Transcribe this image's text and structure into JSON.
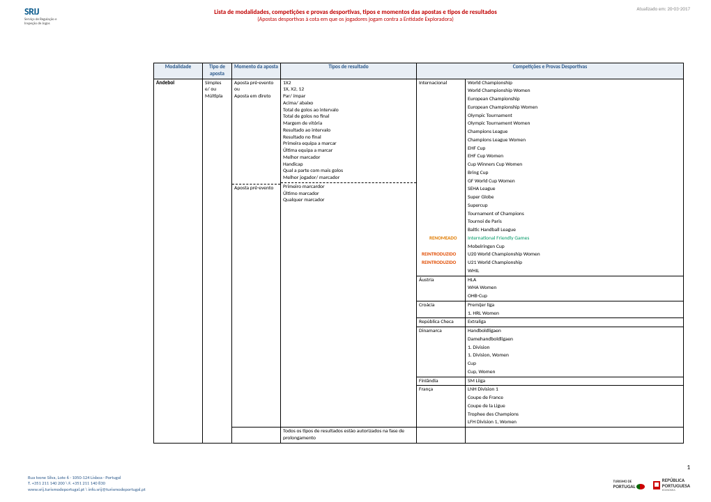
{
  "header": {
    "logo_main": "SRIJ",
    "logo_sub": "Serviço de Regulação e Inspeção de Jogos",
    "date": "Atualizado em: 20-03-2017",
    "title": "Lista de modalidades, competições e provas desportivas, tipos e momentos das apostas e tipos de resultados",
    "subtitle": "(Apostas desportivas à cota em que os jogadores jogam contra a Entidade Exploradora)"
  },
  "columns": {
    "modalidade": "Modalidade",
    "tipo": "Tipo de aposta",
    "momento": "Momento da aposta",
    "tiposres": "Tipos de resultado",
    "comp": "Competições e Provas Desportivas"
  },
  "modalidade": "Andebol",
  "tipo_aposta": [
    "Simples",
    "e/ ou",
    "Múltipla"
  ],
  "momento1": [
    "Aposta pré-evento",
    "ou",
    "Aposta em direto"
  ],
  "momento2": "Aposta pré-evento",
  "tipos_resultado_a": [
    "1X2",
    "1X, X2, 12",
    "Par/ ímpar",
    "Acima/ abaixo",
    "Total de golos ao intervalo",
    "Total de golos no final",
    "Margem de vitória",
    "Resultado ao intervalo",
    "Resultado no final",
    "Primeira equipa a marcar",
    "Última equipa a marcar",
    "Melhor marcador",
    "Handicap",
    "Qual a parte com mais golos",
    "Melhor jogador/ marcador"
  ],
  "tipos_resultado_b": [
    "Primeiro marcardor",
    "Último marcador",
    "Qualquer marcador"
  ],
  "prolong": "Todos os tipos de resultados estão autorizados na fase de prolongamento",
  "groups": [
    {
      "country": "Internacional",
      "comps": [
        {
          "t": "World Championship"
        },
        {
          "t": "World Championship Women"
        },
        {
          "t": "European Championship"
        },
        {
          "t": "European Championship Women"
        },
        {
          "t": "Olympic Tournament"
        },
        {
          "t": "Olympic Tournament Women"
        },
        {
          "t": "Champions League"
        },
        {
          "t": "Champions League Women"
        },
        {
          "t": "EHF Cup"
        },
        {
          "t": "EHF Cup Women"
        },
        {
          "t": "Cup Winners Cup Women"
        },
        {
          "t": "Bring Cup"
        },
        {
          "t": "GF World Cup Women"
        },
        {
          "t": "SEHA League"
        },
        {
          "t": "Super Globe"
        },
        {
          "t": "Supercup"
        },
        {
          "t": "Tournament of Champions"
        },
        {
          "t": "Tournoi de Paris"
        },
        {
          "t": "Baltic Handball League"
        },
        {
          "t": "International Friendly Games",
          "tag": "RENOMEADO",
          "green": true
        },
        {
          "t": "Mobelringen Cup"
        },
        {
          "t": "U20 World Championship Women",
          "tag": "REINTRODUZIDO"
        },
        {
          "t": "U21 World Championship",
          "tag": "REINTRODUZIDO"
        },
        {
          "t": "WHIL"
        }
      ]
    },
    {
      "country": "Áustria",
      "comps": [
        {
          "t": "HLA"
        },
        {
          "t": "WHA Women"
        },
        {
          "t": "OHB-Cup"
        }
      ]
    },
    {
      "country": "Croácia",
      "comps": [
        {
          "t": "Premijer liga"
        },
        {
          "t": "1. HRL Women"
        }
      ]
    },
    {
      "country": "República Checa",
      "comps": [
        {
          "t": "Extraliga"
        }
      ]
    },
    {
      "country": "Dinamarca",
      "comps": [
        {
          "t": "Handboldligaen"
        },
        {
          "t": "Damehandboldligaen"
        },
        {
          "t": "1. Division"
        },
        {
          "t": "1. Division, Women"
        },
        {
          "t": "Cup"
        },
        {
          "t": "Cup, Women"
        }
      ]
    },
    {
      "country": "Finlândia",
      "comps": [
        {
          "t": "SM Liiga"
        }
      ]
    },
    {
      "country": "França",
      "comps": [
        {
          "t": "LNH Division 1"
        },
        {
          "t": "Coupe de France"
        },
        {
          "t": "Coupe de la Ligue"
        },
        {
          "t": "Trophee des Champions"
        },
        {
          "t": "LFH Division 1, Women"
        }
      ]
    }
  ],
  "tags": {
    "renomeado": "RENOMEADO",
    "reintroduzido": "REINTRODUZIDO"
  },
  "footer": {
    "addr": "Rua Ivone Silva, Lote 6 · 1050-124 Lisboa · Portugal",
    "tel": "T. +351 211 140 200 \\ F. +351 211 140 830",
    "web": "www.srij.turismodeportugal.pt \\ info.srij@turismodeportugal.pt",
    "page": "1",
    "logo1a": "TURISMO DE",
    "logo1b": "PORTUGAL",
    "logo2a": "REPÚBLICA",
    "logo2b": "PORTUGUESA",
    "logo2c": "ECONOMIA"
  }
}
